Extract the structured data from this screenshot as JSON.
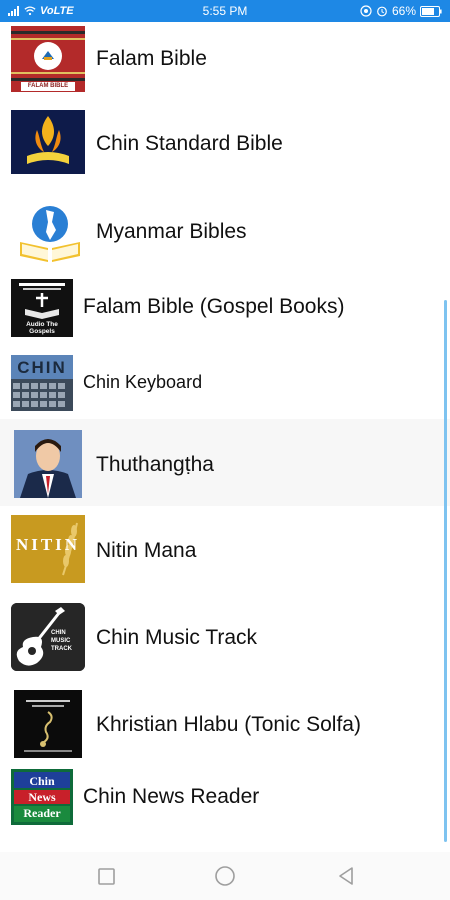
{
  "status_bar": {
    "carrier": "VoLTE",
    "time": "5:55 PM",
    "battery": "66%",
    "icons": [
      "signal-icon",
      "wifi-icon",
      "volte-icon",
      "vpn-icon",
      "alarm-icon",
      "battery-icon"
    ]
  },
  "apps": [
    {
      "name": "Falam Bible",
      "icon": "falam-bible-app-icon",
      "icon_caption": "FALAM BIBLE"
    },
    {
      "name": "Chin Standard Bible",
      "icon": "chin-standard-bible-app-icon"
    },
    {
      "name": "Myanmar Bibles",
      "icon": "myanmar-bibles-app-icon"
    },
    {
      "name": "Falam Bible (Gospel Books)",
      "icon": "falam-gospel-books-app-icon",
      "icon_caption": "Audio The Gospels"
    },
    {
      "name": "Chin Keyboard",
      "icon": "chin-keyboard-app-icon",
      "icon_caption": "CHIN"
    },
    {
      "name": "Thuthangṭha",
      "icon": "thuthangtha-app-icon"
    },
    {
      "name": "Nitin Mana",
      "icon": "nitin-mana-app-icon",
      "icon_caption": "NITIN"
    },
    {
      "name": "Chin Music Track",
      "icon": "chin-music-track-app-icon",
      "icon_caption": "CHIN MUSIC TRACK"
    },
    {
      "name": "Khristian Hlabu (Tonic Solfa)",
      "icon": "khristian-hlabu-app-icon"
    },
    {
      "name": "Chin News Reader",
      "icon": "chin-news-reader-app-icon",
      "icon_caption": "Chin News Reader"
    }
  ],
  "nav_bar": {
    "buttons": [
      "recents-button",
      "home-button",
      "back-button"
    ]
  },
  "colors": {
    "status_bar": "#1e88e5",
    "scrollbar": "#7ec3f0",
    "highlight_row": "#f7f7f7"
  }
}
